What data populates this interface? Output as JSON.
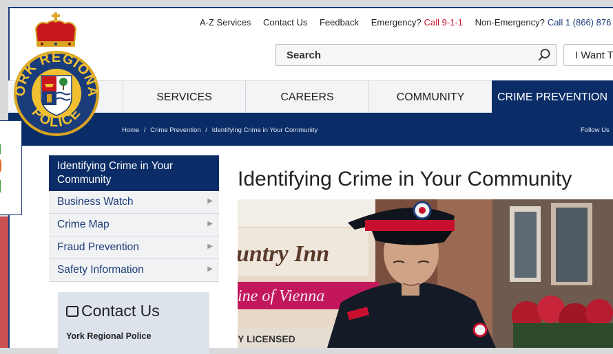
{
  "utility": {
    "az": "A-Z Services",
    "contact": "Contact Us",
    "feedback": "Feedback",
    "emergency_label": "Emergency?",
    "emergency_call": "Call 9-1-1",
    "nonemergency_label": "Non-Emergency?",
    "nonemergency_call": "Call 1 (866) 876"
  },
  "search": {
    "placeholder": "Search"
  },
  "i_want": "I Want T",
  "logo": {
    "top_text": "YORK REGIONAL",
    "bottom_text": "POLICE"
  },
  "nav": [
    {
      "label": "SERVICES"
    },
    {
      "label": "CAREERS"
    },
    {
      "label": "COMMUNITY"
    },
    {
      "label": "CRIME PREVENTION"
    }
  ],
  "breadcrumb": {
    "home": "Home",
    "sep": "/",
    "section": "Crime Prevention",
    "current": "Identifying Crime in Your Community"
  },
  "follow": "Follow Us",
  "sidebar": {
    "heading": "Identifying Crime in Your Community",
    "items": [
      {
        "label": "Business Watch"
      },
      {
        "label": "Crime Map"
      },
      {
        "label": "Fraud Prevention"
      },
      {
        "label": "Safety Information"
      }
    ]
  },
  "contact": {
    "title": "Contact Us",
    "org": "York Regional Police"
  },
  "main": {
    "title": "Identifying Crime in Your Community"
  },
  "photo": {
    "sign_top": "untry Inn",
    "sign_mid": "ine of Vienna",
    "sign_bottom": "Y LICENSED"
  },
  "colors": {
    "navy": "#0b2d67",
    "red": "#c8102e",
    "link": "#1b3c7a"
  }
}
